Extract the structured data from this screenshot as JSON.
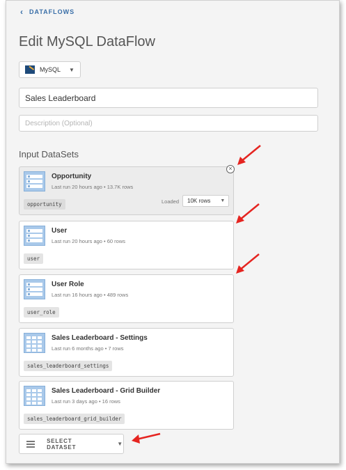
{
  "nav": {
    "back_label": "DATAFLOWS"
  },
  "page": {
    "title": "Edit MySQL DataFlow"
  },
  "connector": {
    "label": "MySQL"
  },
  "form": {
    "name_value": "Sales Leaderboard",
    "description_placeholder": "Description (Optional)"
  },
  "inputs": {
    "section_title": "Input DataSets",
    "loaded_label": "Loaded",
    "loaded_value": "10K rows",
    "select_label": "SELECT DATASET",
    "items": [
      {
        "name": "Opportunity",
        "meta": "Last run 20 hours ago • 13.7K rows",
        "tag": "opportunity",
        "icon": "table-rows-icon"
      },
      {
        "name": "User",
        "meta": "Last run 20 hours ago • 60 rows",
        "tag": "user",
        "icon": "table-rows-icon"
      },
      {
        "name": "User Role",
        "meta": "Last run 16 hours ago • 489 rows",
        "tag": "user_role",
        "icon": "table-rows-icon"
      },
      {
        "name": "Sales Leaderboard - Settings",
        "meta": "Last run 6 months ago • 7 rows",
        "tag": "sales_leaderboard_settings",
        "icon": "table-grid-icon"
      },
      {
        "name": "Sales Leaderboard - Grid Builder",
        "meta": "Last run 3 days ago • 16 rows",
        "tag": "sales_leaderboard_grid_builder",
        "icon": "table-grid-icon"
      }
    ]
  },
  "colors": {
    "accent": "#3a6fa8",
    "annotation": "#e52420",
    "icon_fill": "#a9c9ea"
  }
}
